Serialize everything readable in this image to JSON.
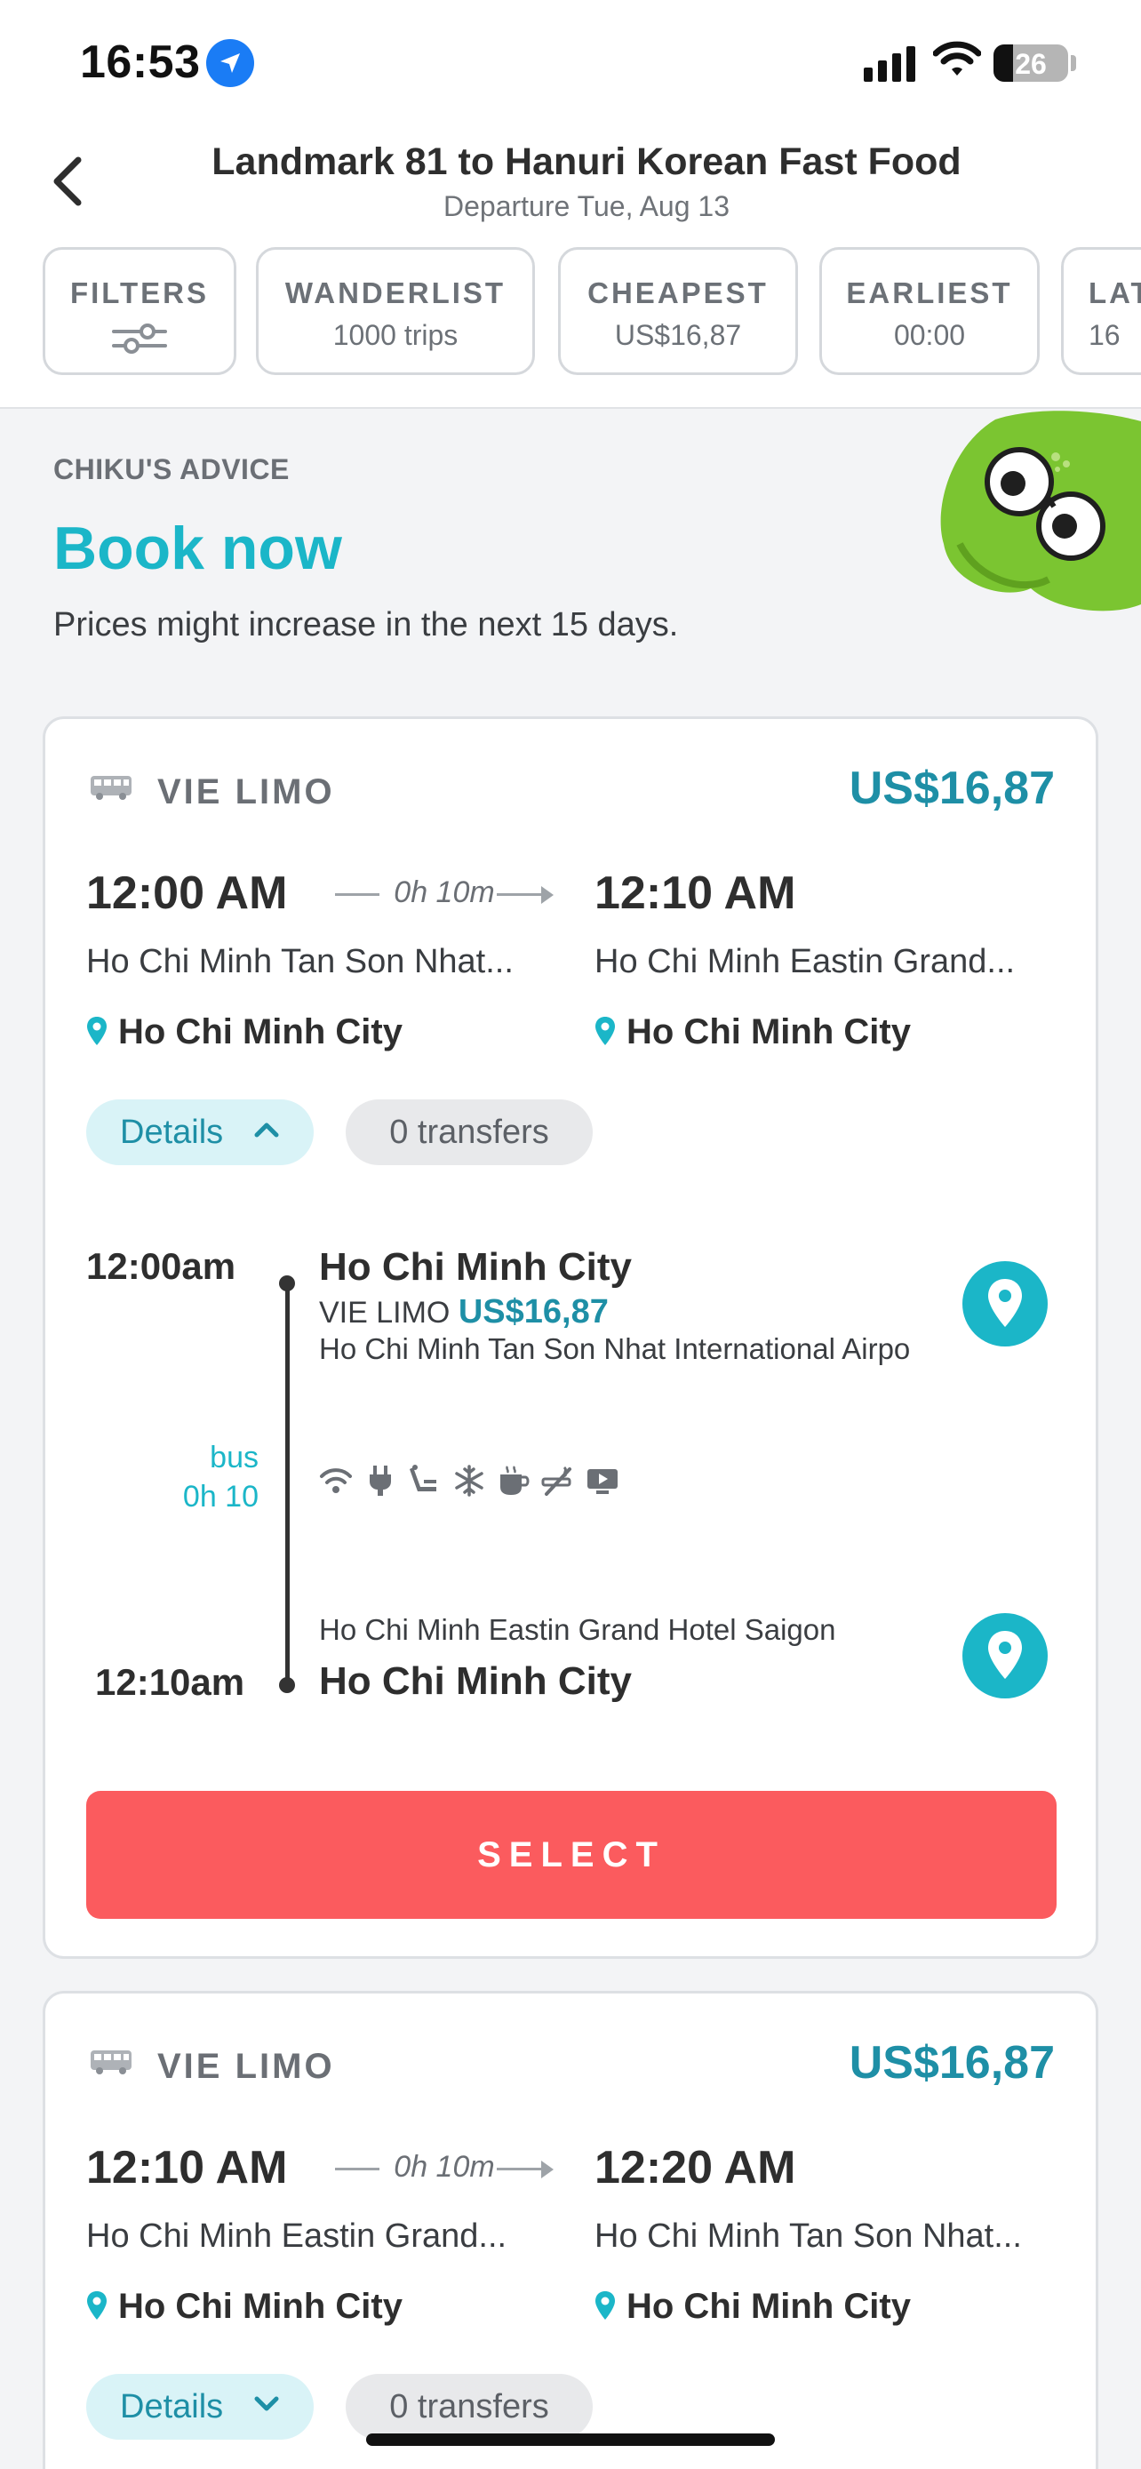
{
  "status": {
    "time": "16:53",
    "battery": "26"
  },
  "header": {
    "title": "Landmark 81 to Hanuri Korean Fast Food",
    "subtitle": "Departure Tue, Aug 13",
    "chips": [
      {
        "label": "FILTERS",
        "value": ""
      },
      {
        "label": "WANDERLIST",
        "value": "1000 trips"
      },
      {
        "label": "CHEAPEST",
        "value": "US$16,87"
      },
      {
        "label": "EARLIEST",
        "value": "00:00"
      },
      {
        "label": "LAT",
        "value": "16"
      }
    ]
  },
  "advice": {
    "label": "CHIKU'S ADVICE",
    "title": "Book now",
    "text": "Prices might increase in the next 15 days."
  },
  "trips": [
    {
      "operator": "VIE LIMO",
      "price": "US$16,87",
      "dep_time": "12:00 AM",
      "arr_time": "12:10 AM",
      "duration": "0h 10m",
      "dep_stop": "Ho Chi Minh Tan Son Nhat...",
      "arr_stop": "Ho Chi Minh Eastin Grand...",
      "dep_city": "Ho Chi Minh City",
      "arr_city": "Ho Chi Minh City",
      "details_label": "Details",
      "transfers": "0 transfers",
      "timeline": {
        "dep_time": "12:00am",
        "arr_time": "12:10am",
        "dep_city": "Ho Chi Minh City",
        "arr_city": "Ho Chi Minh City",
        "operator": "VIE LIMO",
        "price": "US$16,87",
        "dep_address": "Ho Chi Minh Tan Son Nhat International Airpo",
        "arr_address": "Ho Chi Minh Eastin Grand Hotel Saigon",
        "mode": "bus",
        "duration": "0h 10",
        "amenities": [
          "wifi-icon",
          "power-outlet-icon",
          "reclining-seat-icon",
          "air-conditioning-icon",
          "coffee-icon",
          "no-smoking-icon",
          "tv-icon"
        ]
      },
      "select_label": "SELECT"
    },
    {
      "operator": "VIE LIMO",
      "price": "US$16,87",
      "dep_time": "12:10 AM",
      "arr_time": "12:20 AM",
      "duration": "0h 10m",
      "dep_stop": "Ho Chi Minh Eastin Grand...",
      "arr_stop": "Ho Chi Minh Tan Son Nhat...",
      "dep_city": "Ho Chi Minh City",
      "arr_city": "Ho Chi Minh City",
      "details_label": "Details",
      "transfers": "0 transfers"
    }
  ],
  "colors": {
    "accent": "#1bb6c8",
    "price": "#1e8fa6",
    "select": "#fb5b5e",
    "mascot": "#7bc531"
  }
}
